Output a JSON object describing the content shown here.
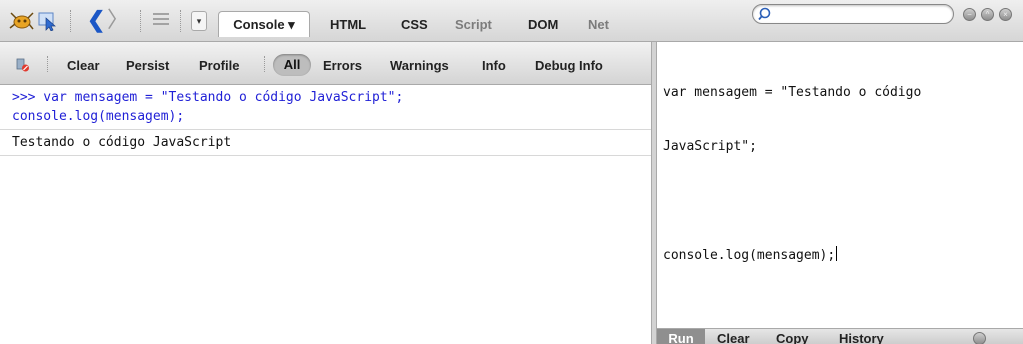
{
  "toolbar": {
    "icons": {
      "firebug": "firebug-icon",
      "inspect": "inspect-element-icon",
      "back": "back-arrow-icon",
      "forward": "forward-arrow-icon",
      "list": "list-icon",
      "dropdown": "dropdown-arrow-icon"
    },
    "nav_back_glyph": "❮",
    "nav_forward_glyph": "〉",
    "dropdown_glyph": "▾",
    "tabs": [
      {
        "label": "Console ▾",
        "active": true
      },
      {
        "label": "HTML",
        "active": false
      },
      {
        "label": "CSS",
        "active": false
      },
      {
        "label": "Script",
        "active": false
      },
      {
        "label": "DOM",
        "active": false
      },
      {
        "label": "Net",
        "active": false
      }
    ],
    "search": {
      "value": "",
      "placeholder": ""
    }
  },
  "console_toolbar": {
    "items": [
      "Clear",
      "Persist",
      "Profile",
      "All",
      "Errors",
      "Warnings",
      "Info",
      "Debug Info"
    ],
    "selected": "All"
  },
  "console_log": {
    "command_line_1": ">>> var mensagem = \"Testando o código JavaScript\";",
    "command_line_2": "console.log(mensagem);",
    "output": "Testando o código JavaScript"
  },
  "command_editor": {
    "line_1": "var mensagem = \"Testando o código",
    "line_2": "JavaScript\";",
    "line_3": "console.log(mensagem);"
  },
  "editor_toolbar": {
    "run": "Run",
    "clear": "Clear",
    "copy": "Copy",
    "history": "History"
  },
  "colors": {
    "command_text": "#1f1fd6",
    "nav_back": "#1b57c6",
    "toolbar_bg": "#d6d6d6"
  }
}
